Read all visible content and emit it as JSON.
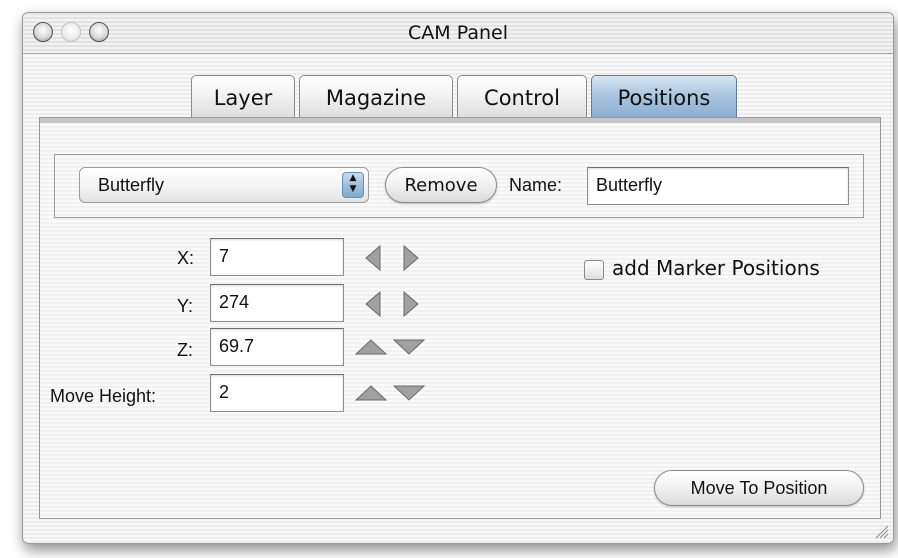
{
  "window": {
    "title": "CAM Panel"
  },
  "tabs": [
    {
      "label": "Layer",
      "active": false
    },
    {
      "label": "Magazine",
      "active": false
    },
    {
      "label": "Control",
      "active": false
    },
    {
      "label": "Positions",
      "active": true
    }
  ],
  "position_selector": {
    "selected": "Butterfly",
    "remove_label": "Remove",
    "name_label": "Name:",
    "name_value": "Butterfly"
  },
  "coordinates": {
    "x_label": "X:",
    "x_value": "7",
    "y_label": "Y:",
    "y_value": "274",
    "z_label": "Z:",
    "z_value": "69.7",
    "move_height_label": "Move Height:",
    "move_height_value": "2"
  },
  "options": {
    "add_marker_label": "add Marker Positions",
    "add_marker_checked": false
  },
  "actions": {
    "move_to_position_label": "Move To Position"
  },
  "colors": {
    "active_tab": "#88acd0",
    "arrow_fill": "#9a9a9a"
  }
}
